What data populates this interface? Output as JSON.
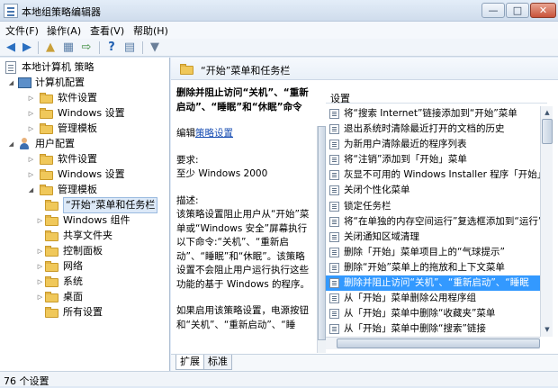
{
  "window": {
    "title": "本地组策略编辑器",
    "controls": {
      "minimize": "—",
      "maximize": "□",
      "close": "✕"
    }
  },
  "menu": [
    "文件(F)",
    "操作(A)",
    "查看(V)",
    "帮助(H)"
  ],
  "tree": {
    "root": "本地计算机 策略",
    "computer": "计算机配置",
    "computer_children": [
      "软件设置",
      "Windows 设置",
      "管理模板"
    ],
    "user": "用户配置",
    "user_children": [
      "软件设置",
      "Windows 设置",
      "管理模板"
    ],
    "admin_children": [
      "“开始”菜单和任务栏",
      "Windows 组件",
      "共享文件夹",
      "控制面板",
      "网络",
      "系统",
      "桌面",
      "所有设置"
    ]
  },
  "header": {
    "title": "“开始”菜单和任务栏"
  },
  "description": {
    "title": "删除并阻止访问“关机”、“重新启动”、“睡眠”和“休眠”命令",
    "edit_prefix": "编辑",
    "edit_link": "策略设置",
    "req_label": "要求:",
    "req_value": "至少 Windows 2000",
    "desc_label": "描述:",
    "desc_text": "该策略设置阻止用户从“开始”菜单或“Windows 安全”屏幕执行以下命令:“关机”、“重新启动”、“睡眠”和“休眠”。该策略设置不会阻止用户运行执行这些功能的基于 Windows 的程序。",
    "more_text": "如果启用该策略设置，电源按钮和“关机”、“重新启动”、“睡眠”和“休眠”命令将从“开始”"
  },
  "settings": {
    "column_header": "设置",
    "selected_index": 11,
    "rows": [
      "将“搜索 Internet”链接添加到“开始”菜单",
      "退出系统时清除最近打开的文档的历史",
      "为新用户清除最近的程序列表",
      "将“注销”添加到「开始」菜单",
      "灰显不可用的 Windows Installer 程序「开始」菜",
      "关闭个性化菜单",
      "锁定任务栏",
      "将“在单独的内存空间运行”复选框添加到“运行”",
      "关闭通知区域清理",
      "删除「开始」菜单项目上的“气球提示”",
      "删除“开始”菜单上的拖放和上下文菜单",
      "删除并阻止访问“关机”、“重新启动”、“睡眠",
      "从「开始」菜单删除公用程序组",
      "从「开始」菜单中删除“收藏夹”菜单",
      "从「开始」菜单中删除“搜索”链接"
    ]
  },
  "tabs": [
    "扩展",
    "标准"
  ],
  "status": {
    "text": "76 个设置"
  }
}
